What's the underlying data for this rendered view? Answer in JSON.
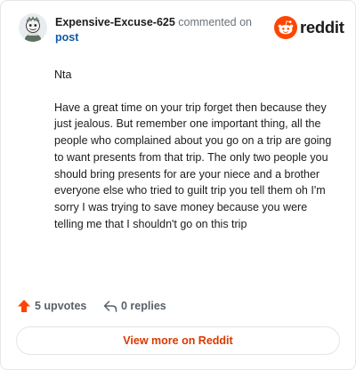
{
  "comment": {
    "author": "Expensive-Excuse-625",
    "action_text": "commented on",
    "post_link": "post",
    "paragraphs": [
      "Nta",
      "Have a great time on your trip forget then because they just jealous. But remember one important thing, all the people who complained about you go on a trip are going to want presents from that trip. The only two people you should bring presents for are your niece and a brother everyone else who tried to guilt trip you tell them oh I'm sorry I was trying to save money because you were telling me that I shouldn't go on this trip"
    ]
  },
  "brand": {
    "wordmark": "reddit",
    "icon": "reddit-snoo-icon",
    "color": "#ff4500"
  },
  "stats": {
    "upvotes": "5 upvotes",
    "replies": "0 replies",
    "upvote_icon": "upvote-arrow-icon",
    "reply_icon": "reply-arrow-icon",
    "upvote_color": "#ff4500"
  },
  "cta": {
    "label": "View more on Reddit",
    "color": "#d93a00"
  }
}
